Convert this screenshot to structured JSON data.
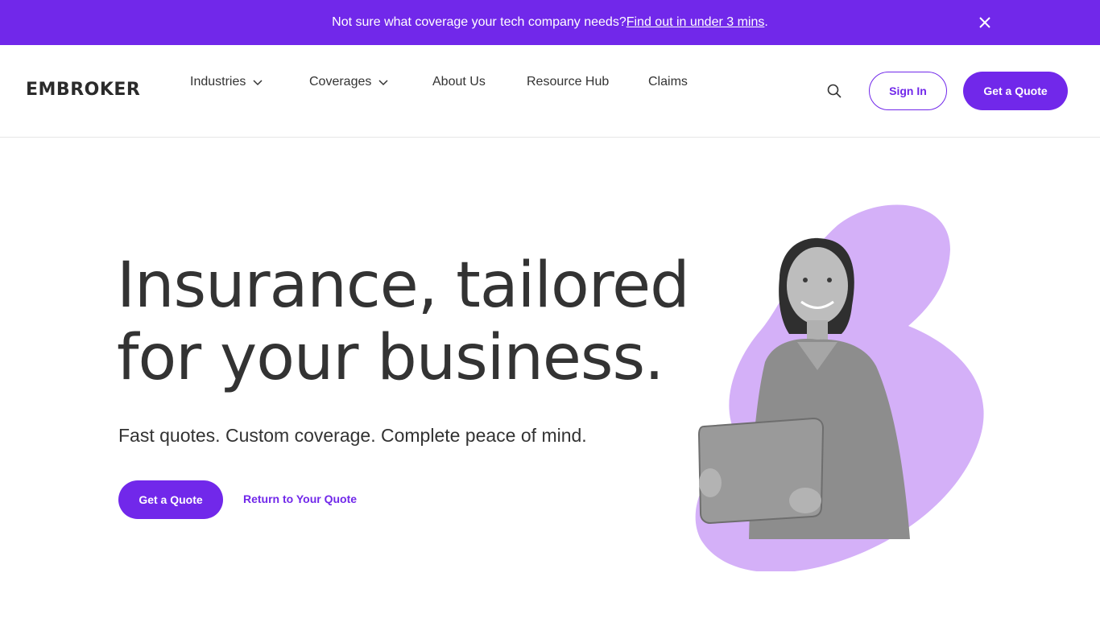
{
  "banner": {
    "text": "Not sure what coverage your tech company needs? ",
    "link": "Find out in under 3 mins",
    "suffix": "."
  },
  "header": {
    "logo": "EMBROKER",
    "nav": {
      "industries": "Industries",
      "coverages": "Coverages",
      "about": "About Us",
      "resource": "Resource Hub",
      "claims": "Claims"
    },
    "sign_in": "Sign In",
    "get_quote": "Get a Quote"
  },
  "hero": {
    "title_line1": "Insurance, tailored",
    "title_line2": "for your business.",
    "subtitle": "Fast quotes. Custom coverage. Complete peace of mind.",
    "cta": "Get a Quote",
    "secondary": "Return to Your Quote"
  },
  "colors": {
    "brand": "#7128ea",
    "accent_blob": "#d4b0f8",
    "text": "#333333"
  },
  "icons": {
    "close": "close-icon",
    "search": "search-icon",
    "chevron": "chevron-down-icon"
  }
}
